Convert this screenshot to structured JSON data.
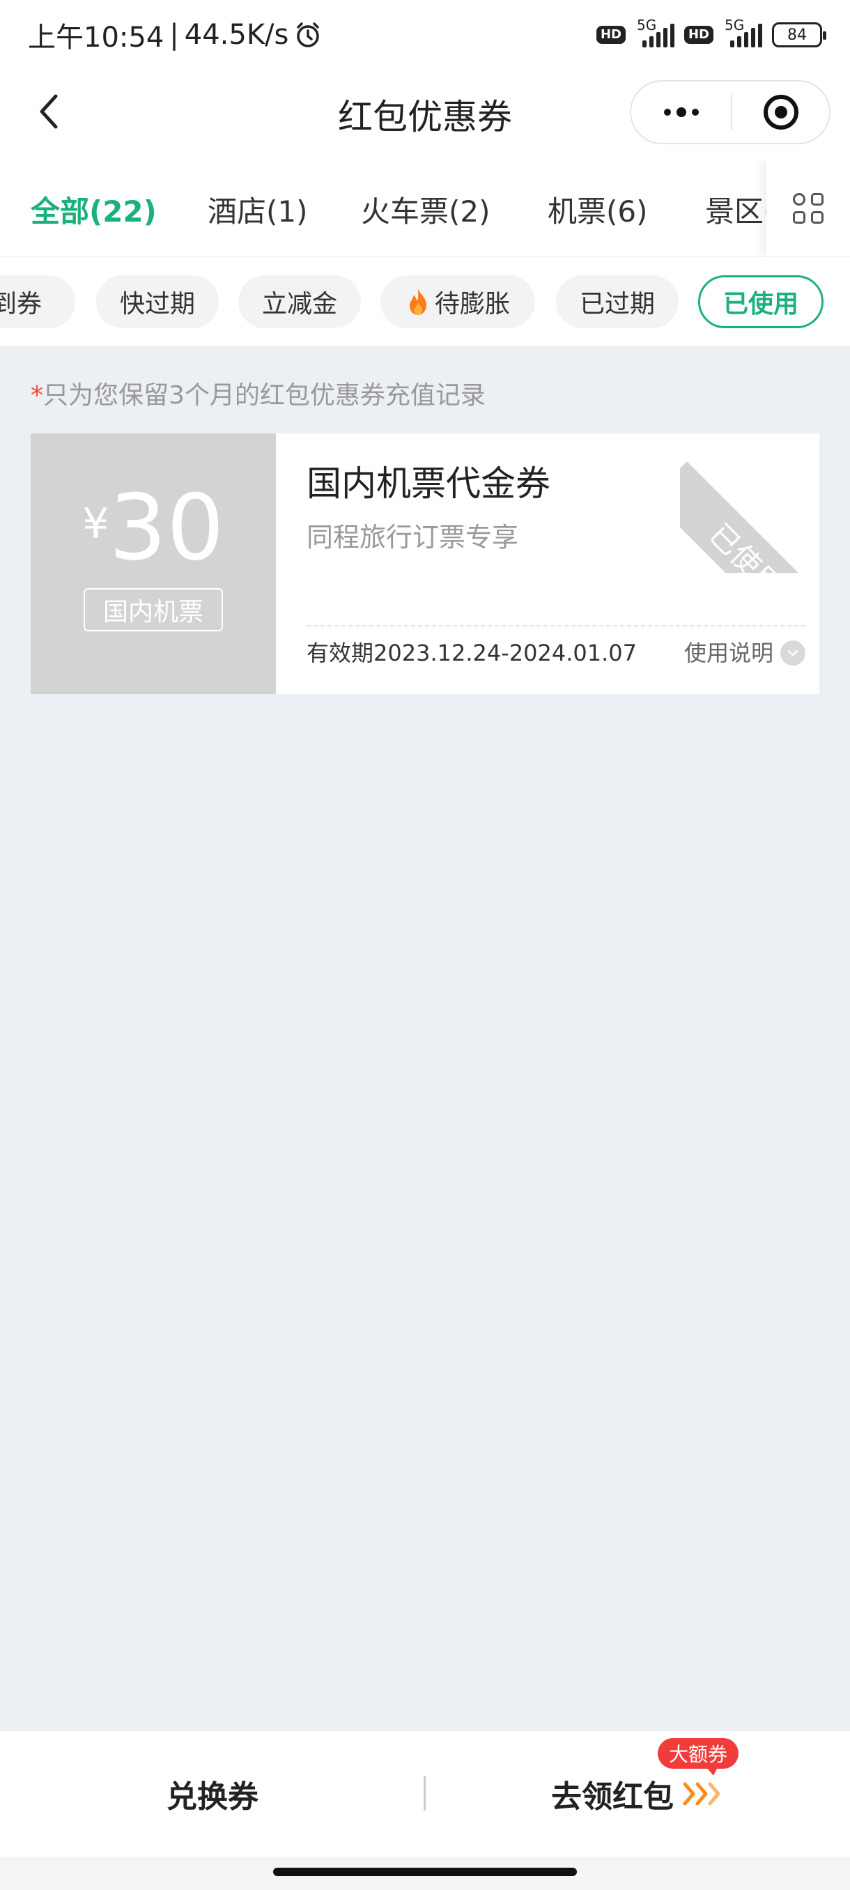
{
  "status_bar": {
    "time": "上午10:54",
    "separator": "|",
    "speed": "44.5K/s",
    "hd_label": "HD",
    "network": "5G",
    "battery": "84"
  },
  "header": {
    "title": "红包优惠券"
  },
  "categories": [
    {
      "label": "全部(22)",
      "active": true
    },
    {
      "label": "酒店(1)",
      "active": false
    },
    {
      "label": "火车票(2)",
      "active": false
    },
    {
      "label": "机票(6)",
      "active": false
    },
    {
      "label": "景区(",
      "active": false
    }
  ],
  "filters": [
    {
      "label": "到券",
      "active": false
    },
    {
      "label": "快过期",
      "active": false
    },
    {
      "label": "立减金",
      "active": false
    },
    {
      "label": "待膨胀",
      "active": false,
      "icon": "flame-icon"
    },
    {
      "label": "已过期",
      "active": false
    },
    {
      "label": "已使用",
      "active": true
    }
  ],
  "notice": {
    "star": "*",
    "text": "只为您保留3个月的红包优惠券充值记录"
  },
  "coupon": {
    "currency": "¥",
    "amount": "30",
    "scope": "国内机票",
    "title": "国内机票代金券",
    "subtitle": "同程旅行订票专享",
    "validity": "有效期2023.12.24-2024.01.07",
    "usage_label": "使用说明",
    "status": "已使用"
  },
  "bottom_bar": {
    "exchange_label": "兑换券",
    "redpack_label": "去领红包",
    "badge": "大额券"
  },
  "colors": {
    "accent": "#1bb17a",
    "badge": "#f13c3c",
    "arrow": "#ff8a1f",
    "coupon_gray": "#d3d3d3",
    "background": "#eceff4"
  }
}
